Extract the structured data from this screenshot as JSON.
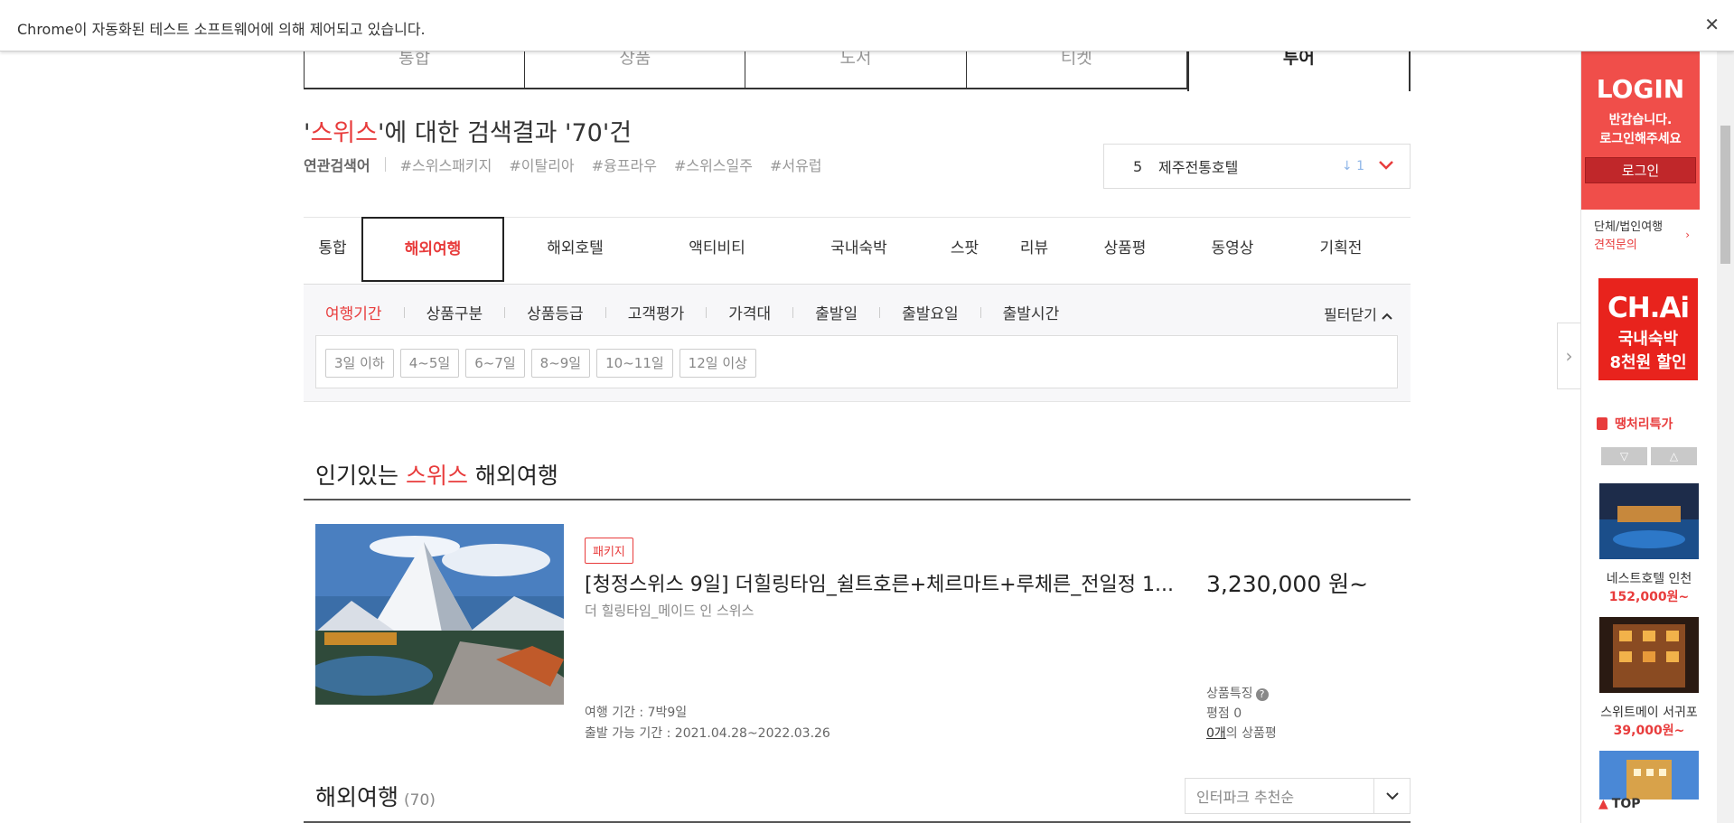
{
  "infobar": {
    "message": "Chrome이 자동화된 테스트 소프트웨어에 의해 제어되고 있습니다.",
    "close": "✕"
  },
  "search_tabs": [
    "통합",
    "상품",
    "도서",
    "티켓",
    "투어"
  ],
  "result": {
    "quote_open": "'",
    "keyword": "스위스",
    "mid": "'에 대한 검색결과 '",
    "count": "70",
    "end": "'건"
  },
  "related": {
    "label": "연관검색어",
    "tags": [
      "#스위스패키지",
      "#이탈리아",
      "#융프라우",
      "#스위스일주",
      "#서유럽"
    ]
  },
  "ranking": {
    "rank": "5",
    "name": "제주전통호텔",
    "move": "↓ 1"
  },
  "category_tabs": [
    "통합",
    "해외여행",
    "해외호텔",
    "액티비티",
    "국내숙박",
    "스팟",
    "리뷰",
    "상품평",
    "동영상",
    "기획전"
  ],
  "filters": {
    "items": [
      "여행기간",
      "상품구분",
      "상품등급",
      "고객평가",
      "가격대",
      "출발일",
      "출발요일",
      "출발시간"
    ],
    "close_label": "필터닫기",
    "chips": [
      "3일 이하",
      "4~5일",
      "6~7일",
      "8~9일",
      "10~11일",
      "12일 이상"
    ]
  },
  "popular": {
    "prefix": "인기있는 ",
    "keyword": "스위스",
    "suffix": " 해외여행"
  },
  "product": {
    "badge": "패키지",
    "title": "[청정스위스 9일] 더힐링타임_쉴트호른+체르마트+루체른_전일정 1...",
    "subtitle": "더 힐링타임_메이드 인 스위스",
    "duration": "여행 기간 : 7박9일",
    "dates": "출발 가능 기간 : 2021.04.28~2022.03.26",
    "price": "3,230,000 원~",
    "feature_label": "상품특징",
    "score": "평점 0",
    "review_count": "0개",
    "review_suffix": "의 상품평"
  },
  "overseas": {
    "title": "해외여행",
    "count": "(70)",
    "sort": "인터파크 추천순"
  },
  "sidebar": {
    "login_title": "LOGIN",
    "welcome1": "반갑습니다.",
    "welcome2": "로그인해주세요",
    "login_button": "로그인",
    "corp1": "단체/법인여행",
    "corp2": "견적문의",
    "ad_logo": "CH.Ai",
    "ad_line1": "국내숙박",
    "ad_line2": "8천원 할인",
    "deal": "땡처리특가",
    "hotels": [
      {
        "name": "네스트호텔 인천",
        "price": "152,000원~"
      },
      {
        "name": "스위트메이 서귀포",
        "price": "39,000원~"
      }
    ],
    "top": "TOP"
  },
  "colors": {
    "accent": "#e83c3c",
    "login_bg": "#f04e4a"
  }
}
